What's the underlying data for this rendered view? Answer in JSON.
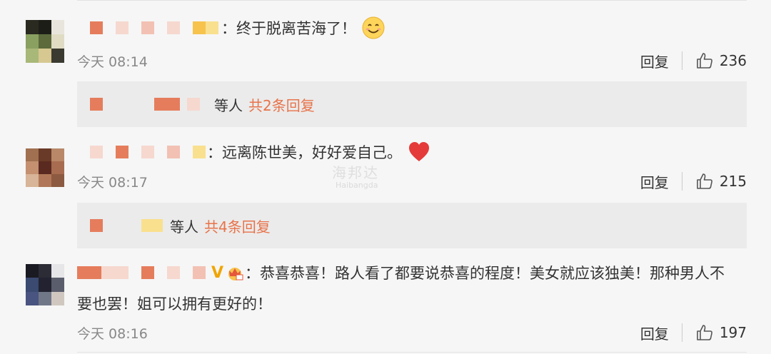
{
  "comments": [
    {
      "text": "：终于脱离苦海了！",
      "time": "今天 08:14",
      "reply_label": "回复",
      "likes": "236",
      "emoji": "smiling-face-emoji"
    },
    {
      "text": "：远离陈世美，好好爱自己。",
      "time": "今天 08:17",
      "reply_label": "回复",
      "likes": "215",
      "emoji": "red-heart-emoji"
    },
    {
      "text_line1": "：恭喜恭喜！路人看了都要说恭喜的程度！美女就应该独美！那种男人不",
      "text_line2": "要也罢！姐可以拥有更好的！",
      "time": "今天 08:16",
      "reply_label": "回复",
      "likes": "197",
      "badge": "V"
    }
  ],
  "reply_boxes": [
    {
      "label": "等人",
      "count_text": "共2条回复"
    },
    {
      "label": "等人",
      "count_text": "共4条回复"
    }
  ],
  "watermark": {
    "main": "海邦达",
    "sub": "Haibangda"
  },
  "colors": {
    "accent": "#e8734a",
    "background": "#f6f6f6",
    "reply_box": "#ebebeb"
  }
}
